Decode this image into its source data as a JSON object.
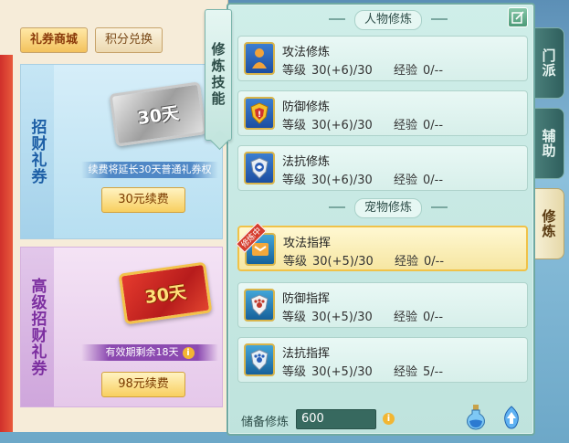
{
  "shop": {
    "tabs": [
      {
        "label": "礼券商城",
        "active": true
      },
      {
        "label": "积分兑换",
        "active": false
      }
    ],
    "cards": [
      {
        "side_title": "招财礼券",
        "ticket_text": "30天",
        "notice": "续费将延长30天普通礼券权",
        "button": "30元续费"
      },
      {
        "side_title": "高级招财礼券",
        "ticket_text": "30天",
        "notice": "有效期剩余18天",
        "button": "98元续费"
      }
    ]
  },
  "skill_tag": "修炼技能",
  "side_tabs": [
    {
      "label": "门派",
      "active": false
    },
    {
      "label": "辅助",
      "active": false
    },
    {
      "label": "修炼",
      "active": true
    }
  ],
  "panel": {
    "sections": [
      {
        "title": "人物修炼",
        "rows": [
          {
            "name": "攻法修炼",
            "level_label": "等级",
            "level": "30(+6)/30",
            "exp_label": "经验",
            "exp": "0/--",
            "icon": "attack-magic-icon"
          },
          {
            "name": "防御修炼",
            "level_label": "等级",
            "level": "30(+6)/30",
            "exp_label": "经验",
            "exp": "0/--",
            "icon": "defense-shield-icon"
          },
          {
            "name": "法抗修炼",
            "level_label": "等级",
            "level": "30(+6)/30",
            "exp_label": "经验",
            "exp": "0/--",
            "icon": "magic-resist-shield-icon"
          }
        ]
      },
      {
        "title": "宠物修炼",
        "rows": [
          {
            "name": "攻法指挥",
            "level_label": "等级",
            "level": "30(+5)/30",
            "exp_label": "经验",
            "exp": "0/--",
            "icon": "pet-attack-icon",
            "ribbon": "修炼中",
            "highlight": true
          },
          {
            "name": "防御指挥",
            "level_label": "等级",
            "level": "30(+5)/30",
            "exp_label": "经验",
            "exp": "0/--",
            "icon": "pet-defense-icon"
          },
          {
            "name": "法抗指挥",
            "level_label": "等级",
            "level": "30(+5)/30",
            "exp_label": "经验",
            "exp": "5/--",
            "icon": "pet-resist-icon"
          }
        ]
      }
    ],
    "footer": {
      "reserve_label": "储备修炼",
      "reserve_value": "600"
    }
  },
  "colors": {
    "highlight_border": "#f0c248",
    "panel_bg": "#cfeee9",
    "shop_accent": "#d0302b"
  }
}
